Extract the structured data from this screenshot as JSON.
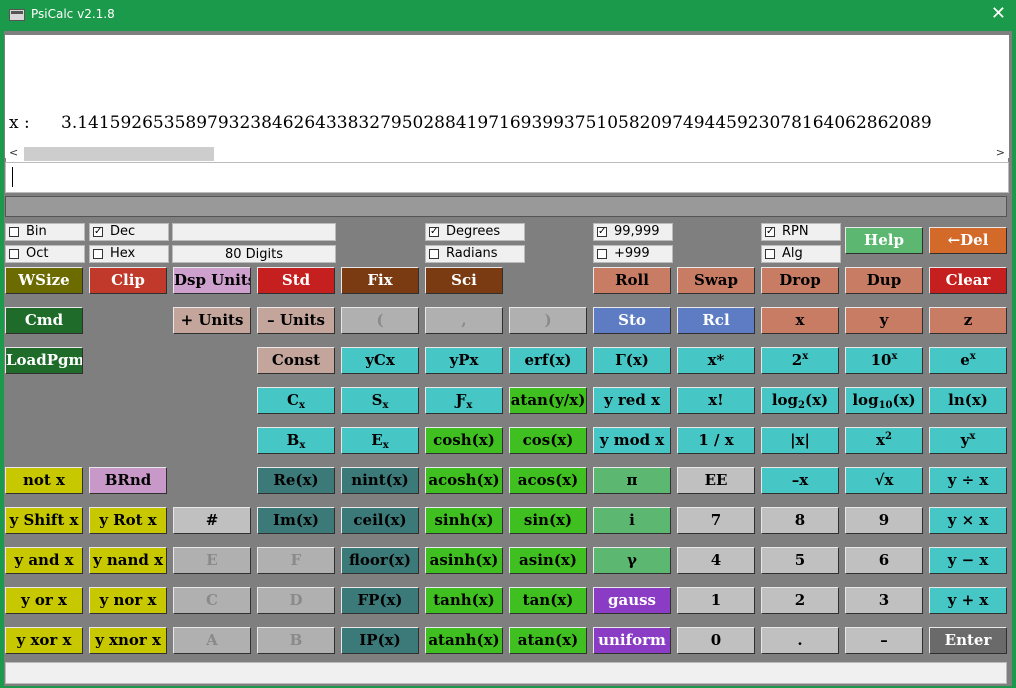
{
  "window": {
    "title": "PsiCalc v2.1.8"
  },
  "display": {
    "x_label": "x :",
    "x_value": "3.1415926535897932384626433832795028841971693993751058209749445923078164062862089"
  },
  "entry": {
    "value": ""
  },
  "options": {
    "bin": "Bin",
    "dec": "Dec",
    "oct": "Oct",
    "hex": "Hex",
    "digits": "80 Digits",
    "degrees": "Degrees",
    "radians": "Radians",
    "p99": "99,999",
    "p999": "+999",
    "rpn": "RPN",
    "alg": "Alg",
    "checked": {
      "bin": false,
      "dec": true,
      "oct": false,
      "hex": false,
      "degrees": true,
      "radians": false,
      "p99": true,
      "p999": false,
      "rpn": true,
      "alg": false
    }
  },
  "buttons": {
    "help": "Help",
    "del": "←Del",
    "wsize": "WSize",
    "clip": "Clip",
    "dsp_units": "Dsp Units",
    "std": "Std",
    "fix": "Fix",
    "sci": "Sci",
    "roll": "Roll",
    "swap": "Swap",
    "drop": "Drop",
    "dup": "Dup",
    "clear": "Clear",
    "cmd": "Cmd",
    "plus_units": "+ Units",
    "minus_units": "– Units",
    "lparen": "(",
    "comma": ",",
    "rparen": ")",
    "sto": "Sto",
    "rcl": "Rcl",
    "x": "x",
    "y": "y",
    "z": "z",
    "loadpgm": "LoadPgm",
    "const": "Const",
    "ycx": "yCx",
    "ypx": "yPx",
    "erf": "erf(x)",
    "gamma_x": "Γ(x)",
    "xstar": "x*",
    "c_x": "Cx",
    "s_x": "Sx",
    "f_x": "Fx",
    "atan2": "atan(y/x)",
    "yred": "y red x",
    "fact": "x!",
    "log2": "log2(x)",
    "log10": "log10(x)",
    "ln": "ln(x)",
    "b_x": "Bx",
    "e_x": "Ex",
    "cosh": "cosh(x)",
    "cos": "cos(x)",
    "ymod": "y mod x",
    "recip": "1 / x",
    "abs": "|x|",
    "notx": "not x",
    "brnd": "BRnd",
    "re": "Re(x)",
    "nint": "nint(x)",
    "acosh": "acosh(x)",
    "acos": "acos(x)",
    "pi": "π",
    "ee": "EE",
    "neg": "–x",
    "sqrt": "√x",
    "div": "y ÷ x",
    "yshift": "y Shift x",
    "yrot": "y Rot x",
    "hash": "#",
    "im": "Im(x)",
    "ceil": "ceil(x)",
    "sinh": "sinh(x)",
    "sin": "sin(x)",
    "i": "i",
    "d7": "7",
    "d8": "8",
    "d9": "9",
    "mul": "y × x",
    "yand": "y and x",
    "ynand": "y nand x",
    "hE": "E",
    "hF": "F",
    "floor": "floor(x)",
    "asinh": "asinh(x)",
    "asin": "asin(x)",
    "gamma_c": "γ",
    "d4": "4",
    "d5": "5",
    "d6": "6",
    "sub": "y − x",
    "yor": "y or x",
    "ynor": "y nor x",
    "hC": "C",
    "hD": "D",
    "fp": "FP(x)",
    "tanh": "tanh(x)",
    "tan": "tan(x)",
    "gauss": "gauss",
    "d1": "1",
    "d2": "2",
    "d3": "3",
    "add": "y + x",
    "yxor": "y xor x",
    "yxnor": "y xnor x",
    "hA": "A",
    "hB": "B",
    "ip": "IP(x)",
    "atanh": "atanh(x)",
    "atan": "atan(x)",
    "uniform": "uniform",
    "d0": "0",
    "dot": ".",
    "minus": "–",
    "enter": "Enter"
  }
}
